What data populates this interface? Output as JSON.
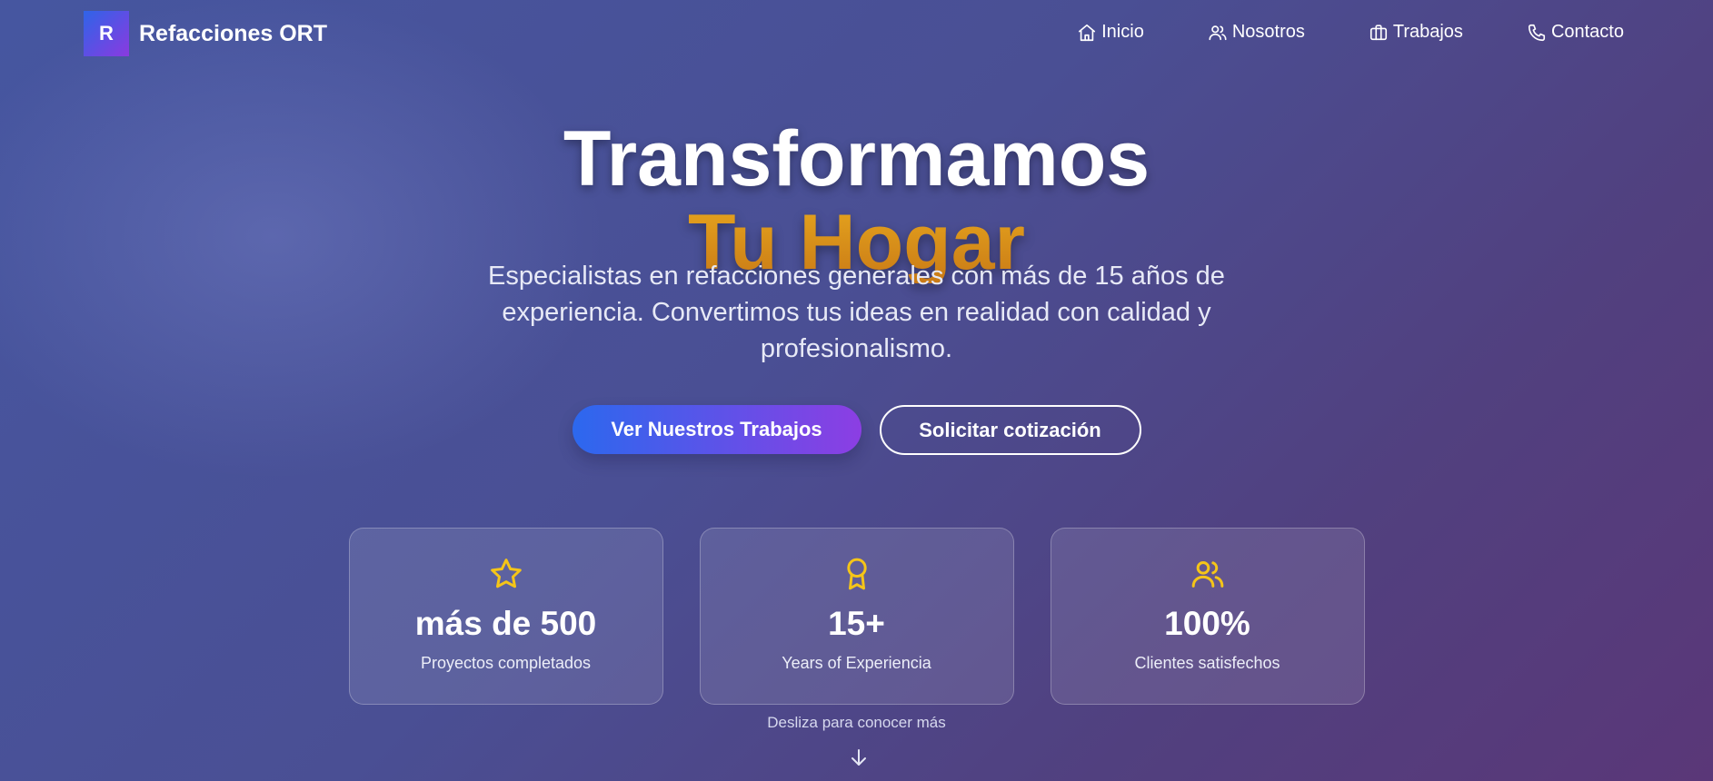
{
  "brand": {
    "logo_letter": "R",
    "name": "Refacciones ORT"
  },
  "nav": {
    "items": [
      {
        "label": "Inicio",
        "icon": "home-icon"
      },
      {
        "label": "Nosotros",
        "icon": "users-icon"
      },
      {
        "label": "Trabajos",
        "icon": "briefcase-icon"
      },
      {
        "label": "Contacto",
        "icon": "phone-icon"
      }
    ]
  },
  "hero": {
    "title_line1": "Transformamos",
    "title_line2": "Tu Hogar",
    "subtitle": "Especialistas en refacciones generales con más de 15 años de experiencia. Convertimos tus ideas en realidad con calidad y profesionalismo.",
    "primary_cta": "Ver Nuestros Trabajos",
    "secondary_cta": "Solicitar cotización"
  },
  "stats": [
    {
      "icon": "star-icon",
      "value": "más de 500",
      "label": "Proyectos completados"
    },
    {
      "icon": "award-icon",
      "value": "15+",
      "label": "Years of Experiencia"
    },
    {
      "icon": "users-icon",
      "value": "100%",
      "label": "Clientes satisfechos"
    }
  ],
  "scroll_hint": "Desliza para conocer más",
  "colors": {
    "accent_gold": "#d8921a",
    "icon_yellow": "#f5c518",
    "cta_gradient_start": "#2c68ee",
    "cta_gradient_end": "#8c3ee3"
  }
}
